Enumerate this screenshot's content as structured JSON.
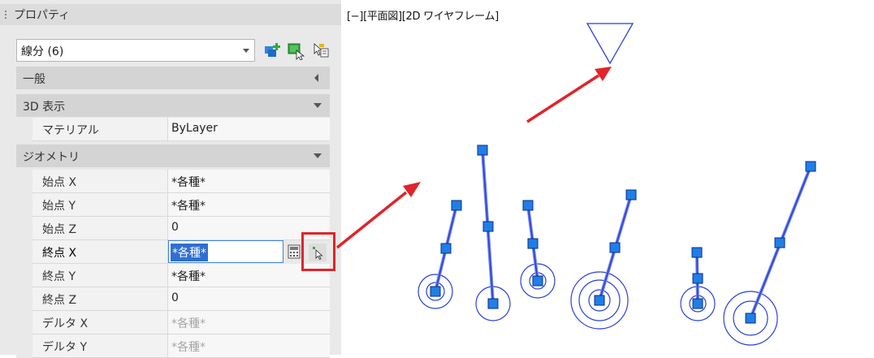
{
  "palette": {
    "title": "プロパティ",
    "selection": "線分 (6)",
    "toolbar": {
      "quick_select_icon": "quick-select-icon",
      "select_objects_icon": "select-objects-icon",
      "toggle_pickadd_icon": "toggle-pickadd-icon"
    },
    "categories": {
      "general": "一般",
      "display3d": "3D 表示",
      "geometry": "ジオメトリ"
    },
    "display3d_rows": [
      {
        "name": "マテリアル",
        "value": "ByLayer"
      }
    ],
    "geometry_rows": [
      {
        "name": "始点 X",
        "value": "*各種*"
      },
      {
        "name": "始点 Y",
        "value": "*各種*"
      },
      {
        "name": "始点 Z",
        "value": "0"
      },
      {
        "name": "終点 X",
        "value": "*各種*"
      },
      {
        "name": "終点 Y",
        "value": "*各種*"
      },
      {
        "name": "終点 Z",
        "value": "0"
      },
      {
        "name": "デルタ X",
        "value": "*各種*"
      },
      {
        "name": "デルタ Y",
        "value": "*各種*"
      }
    ],
    "calculator_icon": "calculator-icon",
    "pick_point_icon": "pick-point-icon"
  },
  "viewport": {
    "label": "[−][平面図][2D ワイヤフレーム]"
  },
  "colors": {
    "accent_red": "#e0242a",
    "line_blue": "#2a3fd8",
    "grip_blue": "#1f7fe6",
    "selection_blue": "#2f6fd1"
  }
}
